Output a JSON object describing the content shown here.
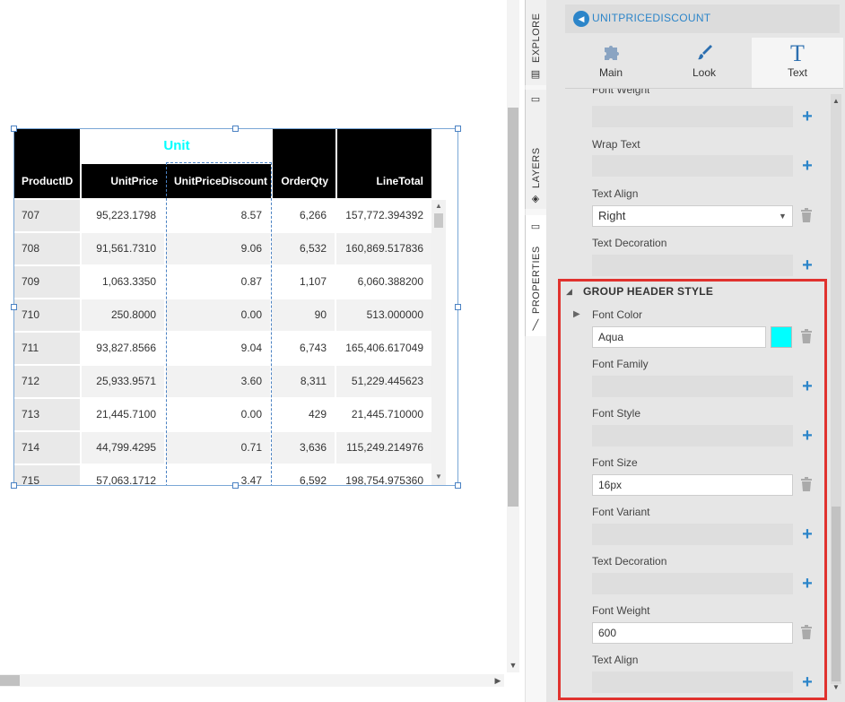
{
  "table": {
    "group_header": "Unit",
    "columns": [
      "ProductID",
      "UnitPrice",
      "UnitPriceDiscount",
      "OrderQty",
      "LineTotal"
    ],
    "rows": [
      [
        "707",
        "95,223.1798",
        "8.57",
        "6,266",
        "157,772.394392"
      ],
      [
        "708",
        "91,561.7310",
        "9.06",
        "6,532",
        "160,869.517836"
      ],
      [
        "709",
        "1,063.3350",
        "0.87",
        "1,107",
        "6,060.388200"
      ],
      [
        "710",
        "250.8000",
        "0.00",
        "90",
        "513.000000"
      ],
      [
        "711",
        "93,827.8566",
        "9.04",
        "6,743",
        "165,406.617049"
      ],
      [
        "712",
        "25,933.9571",
        "3.60",
        "8,311",
        "51,229.445623"
      ],
      [
        "713",
        "21,445.7100",
        "0.00",
        "429",
        "21,445.710000"
      ],
      [
        "714",
        "44,799.4295",
        "0.71",
        "3,636",
        "115,249.214976"
      ],
      [
        "715",
        "57,063.1712",
        "3.47",
        "6,592",
        "198,754.975360"
      ]
    ],
    "group_header_color": "#00ffff"
  },
  "side_tabs": {
    "explore": "EXPLORE",
    "layers": "LAYERS",
    "properties": "PROPERTIES"
  },
  "panel": {
    "title": "UNITPRICEDISCOUNT",
    "tools": [
      {
        "label": "Main",
        "icon": "puzzle-icon"
      },
      {
        "label": "Look",
        "icon": "brush-icon"
      },
      {
        "label": "Text",
        "icon": "text-icon",
        "glyph": "T"
      }
    ],
    "props_top": {
      "font_weight_label": "Font Weight",
      "wrap_text_label": "Wrap Text",
      "text_align_label": "Text Align",
      "text_align_value": "Right",
      "text_decoration_label": "Text Decoration"
    },
    "group_header_style": {
      "title": "GROUP HEADER STYLE",
      "font_color_label": "Font Color",
      "font_color_value": "Aqua",
      "font_color_swatch": "#00ffff",
      "font_family_label": "Font Family",
      "font_style_label": "Font Style",
      "font_size_label": "Font Size",
      "font_size_value": "16px",
      "font_variant_label": "Font Variant",
      "text_decoration_label": "Text Decoration",
      "font_weight_label": "Font Weight",
      "font_weight_value": "600",
      "text_align_label": "Text Align"
    },
    "accent_color": "#2c85c9",
    "highlight_color": "#e0322e"
  }
}
